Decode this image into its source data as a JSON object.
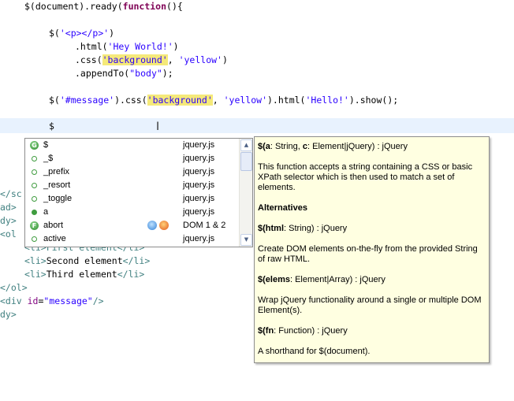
{
  "editor": {
    "lines": {
      "l1": {
        "a": "$(",
        "b": "document",
        "c": ").ready(",
        "kw": "function",
        "d": "(){"
      },
      "l3": {
        "a": "$(",
        "s": "'<p></p>'",
        "b": ")"
      },
      "l4": {
        "a": ".html(",
        "s": "'Hey World!'",
        "b": ")"
      },
      "l5": {
        "a": ".css(",
        "hl": "'background'",
        "b": ", ",
        "s": "'yellow'",
        "c": ")"
      },
      "l6": {
        "a": ".appendTo(",
        "s": "\"body\"",
        "b": ");"
      },
      "l8": {
        "a": "$(",
        "s1": "'#message'",
        "b": ").css(",
        "hl": "'background'",
        "c": ", ",
        "s2": "'yellow'",
        "d": ").html(",
        "s3": "'Hello!'",
        "e": ").show();"
      },
      "l10": {
        "a": "$"
      },
      "m1": {
        "a": "</sc"
      },
      "m2": {
        "a": "ad>"
      },
      "m3": {
        "a": "dy>"
      },
      "m4": {
        "a": "<ol"
      },
      "m5": {
        "a": "<li>First element</li>"
      },
      "m6": {
        "lt": "<li>",
        "text": "Second element",
        "gt": "</li>"
      },
      "m7": {
        "lt": "<li>",
        "text": "Third element",
        "gt": "</li>"
      },
      "m8": {
        "a": "</ol>"
      },
      "m9": {
        "a": "<div ",
        "attr": "id",
        "eq": "=",
        "val": "\"message\"",
        "end": "/>"
      },
      "m10": {
        "a": "dy>"
      }
    }
  },
  "autocomplete": {
    "items": [
      {
        "name": "$",
        "source": "jquery.js",
        "icon": "function-green-icon"
      },
      {
        "name": "_$",
        "source": "jquery.js",
        "icon": "field-ring-icon"
      },
      {
        "name": "_prefix",
        "source": "jquery.js",
        "icon": "field-ring-icon"
      },
      {
        "name": "_resort",
        "source": "jquery.js",
        "icon": "field-ring-icon"
      },
      {
        "name": "_toggle",
        "source": "jquery.js",
        "icon": "field-ring-icon"
      },
      {
        "name": "a",
        "source": "jquery.js",
        "icon": "field-dot-icon"
      },
      {
        "name": "abort",
        "source": "DOM 1 & 2",
        "icon": "method-green-icon"
      },
      {
        "name": "active",
        "source": "jquery.js",
        "icon": "field-ring-icon"
      }
    ]
  },
  "doc": {
    "signature": {
      "fn": "$(",
      "p1": "a",
      "t1": ": String, ",
      "p2": "c",
      "t2": ": Element|jQuery) : jQuery"
    },
    "description": "This function accepts a string containing a CSS or basic XPath selector which is then used to match a set of elements.",
    "alternatives_heading": "Alternatives",
    "alt1": {
      "fn": "$(",
      "p": "html",
      "t": ": String) : jQuery",
      "desc": "Create DOM elements on-the-fly from the provided String of raw HTML."
    },
    "alt2": {
      "fn": "$(",
      "p": "elems",
      "t": ": Element|Array) : jQuery",
      "desc": "Wrap jQuery functionality around a single or multiple DOM Element(s)."
    },
    "alt3": {
      "fn": "$(",
      "p": "fn",
      "t": ": Function) : jQuery",
      "desc": "A shorthand for $(document)."
    }
  }
}
